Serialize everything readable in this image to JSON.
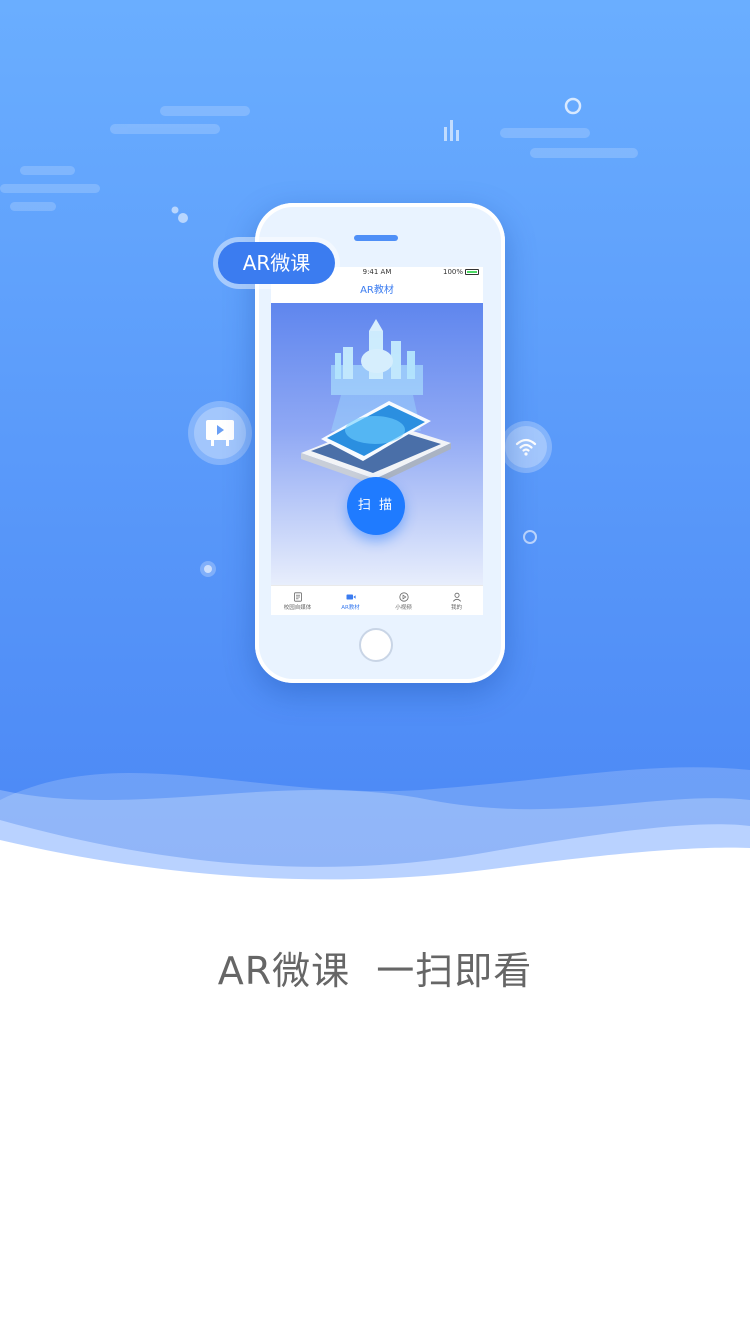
{
  "phone": {
    "status_time": "9:41 AM",
    "status_battery": "100%",
    "nav_title": "AR教材",
    "scan_label": "扫 描",
    "tabs": [
      {
        "label": "校园自媒体",
        "icon": "document-icon",
        "active": false
      },
      {
        "label": "AR教材",
        "icon": "ar-camera-icon",
        "active": true
      },
      {
        "label": "小视频",
        "icon": "play-circle-icon",
        "active": false
      },
      {
        "label": "我的",
        "icon": "person-icon",
        "active": false
      }
    ]
  },
  "badge": {
    "label": "AR微课"
  },
  "floating_icons": [
    "play-board-icon",
    "wifi-icon"
  ],
  "tagline": "AR微课  一扫即看",
  "colors": {
    "sky_top": "#6aaeff",
    "sky_bottom": "#4a86f5",
    "accent": "#3b7cf0",
    "scan_button": "#1f7bff",
    "tagline": "#666666"
  }
}
